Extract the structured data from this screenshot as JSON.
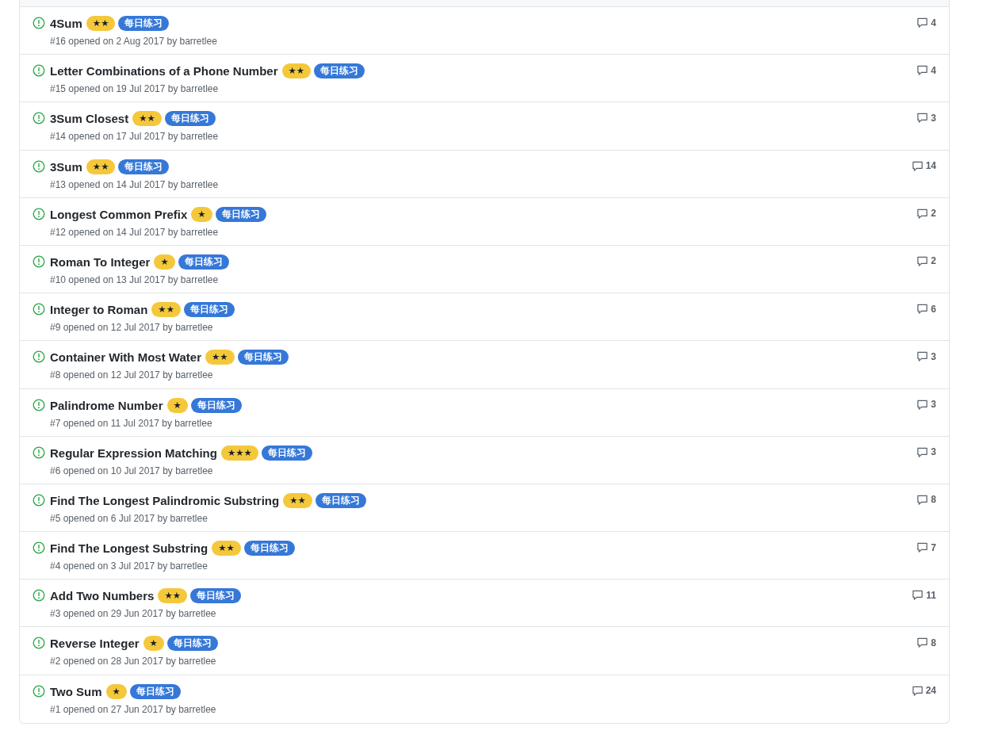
{
  "issues": [
    {
      "title": "4Sum",
      "labels": [
        {
          "text": "★★",
          "color": "#f4c83a"
        },
        {
          "text": "每日练习",
          "color": "#3578d8"
        }
      ],
      "meta": "#16 opened on 2 Aug 2017 by barretlee",
      "comments": "4"
    },
    {
      "title": "Letter Combinations of a Phone Number",
      "labels": [
        {
          "text": "★★",
          "color": "#f4c83a"
        },
        {
          "text": "每日练习",
          "color": "#3578d8"
        }
      ],
      "meta": "#15 opened on 19 Jul 2017 by barretlee",
      "comments": "4"
    },
    {
      "title": "3Sum Closest",
      "labels": [
        {
          "text": "★★",
          "color": "#f4c83a"
        },
        {
          "text": "每日练习",
          "color": "#3578d8"
        }
      ],
      "meta": "#14 opened on 17 Jul 2017 by barretlee",
      "comments": "3"
    },
    {
      "title": "3Sum",
      "labels": [
        {
          "text": "★★",
          "color": "#f4c83a"
        },
        {
          "text": "每日练习",
          "color": "#3578d8"
        }
      ],
      "meta": "#13 opened on 14 Jul 2017 by barretlee",
      "comments": "14"
    },
    {
      "title": "Longest Common Prefix",
      "labels": [
        {
          "text": "★",
          "color": "#f4c83a"
        },
        {
          "text": "每日练习",
          "color": "#3578d8"
        }
      ],
      "meta": "#12 opened on 14 Jul 2017 by barretlee",
      "comments": "2"
    },
    {
      "title": "Roman To Integer",
      "labels": [
        {
          "text": "★",
          "color": "#f4c83a"
        },
        {
          "text": "每日练习",
          "color": "#3578d8"
        }
      ],
      "meta": "#10 opened on 13 Jul 2017 by barretlee",
      "comments": "2"
    },
    {
      "title": "Integer to Roman",
      "labels": [
        {
          "text": "★★",
          "color": "#f4c83a"
        },
        {
          "text": "每日练习",
          "color": "#3578d8"
        }
      ],
      "meta": "#9 opened on 12 Jul 2017 by barretlee",
      "comments": "6"
    },
    {
      "title": "Container With Most Water",
      "labels": [
        {
          "text": "★★",
          "color": "#f4c83a"
        },
        {
          "text": "每日练习",
          "color": "#3578d8"
        }
      ],
      "meta": "#8 opened on 12 Jul 2017 by barretlee",
      "comments": "3"
    },
    {
      "title": "Palindrome Number",
      "labels": [
        {
          "text": "★",
          "color": "#f4c83a"
        },
        {
          "text": "每日练习",
          "color": "#3578d8"
        }
      ],
      "meta": "#7 opened on 11 Jul 2017 by barretlee",
      "comments": "3"
    },
    {
      "title": "Regular Expression Matching",
      "labels": [
        {
          "text": "★★★",
          "color": "#f4c83a"
        },
        {
          "text": "每日练习",
          "color": "#3578d8"
        }
      ],
      "meta": "#6 opened on 10 Jul 2017 by barretlee",
      "comments": "3"
    },
    {
      "title": "Find The Longest Palindromic Substring",
      "labels": [
        {
          "text": "★★",
          "color": "#f4c83a"
        },
        {
          "text": "每日练习",
          "color": "#3578d8"
        }
      ],
      "meta": "#5 opened on 6 Jul 2017 by barretlee",
      "comments": "8"
    },
    {
      "title": "Find The Longest Substring",
      "labels": [
        {
          "text": "★★",
          "color": "#f4c83a"
        },
        {
          "text": "每日练习",
          "color": "#3578d8"
        }
      ],
      "meta": "#4 opened on 3 Jul 2017 by barretlee",
      "comments": "7"
    },
    {
      "title": "Add Two Numbers",
      "labels": [
        {
          "text": "★★",
          "color": "#f4c83a"
        },
        {
          "text": "每日练习",
          "color": "#3578d8"
        }
      ],
      "meta": "#3 opened on 29 Jun 2017 by barretlee",
      "comments": "11"
    },
    {
      "title": "Reverse Integer",
      "labels": [
        {
          "text": "★",
          "color": "#f4c83a"
        },
        {
          "text": "每日练习",
          "color": "#3578d8"
        }
      ],
      "meta": "#2 opened on 28 Jun 2017 by barretlee",
      "comments": "8"
    },
    {
      "title": "Two Sum",
      "labels": [
        {
          "text": "★",
          "color": "#f4c83a"
        },
        {
          "text": "每日练习",
          "color": "#3578d8"
        }
      ],
      "meta": "#1 opened on 27 Jun 2017 by barretlee",
      "comments": "24"
    }
  ]
}
